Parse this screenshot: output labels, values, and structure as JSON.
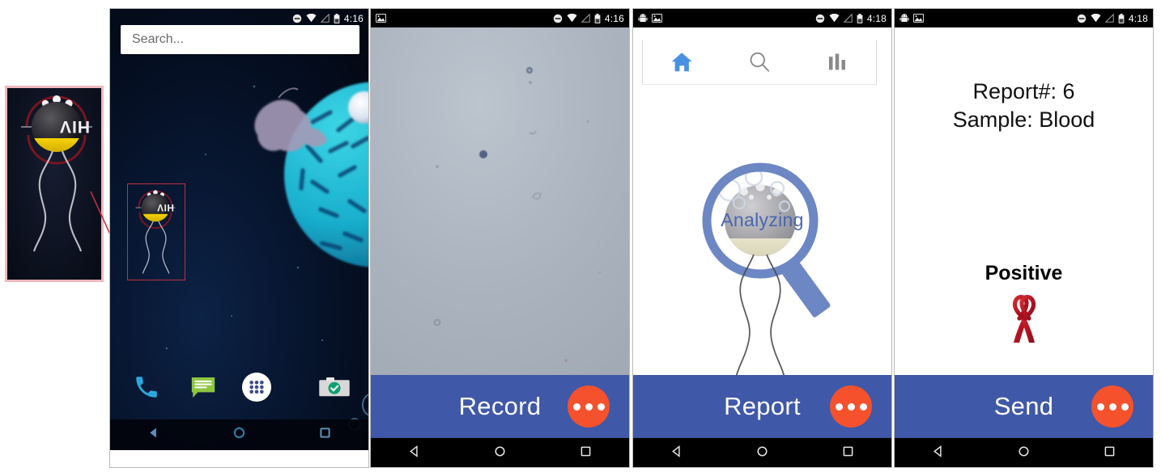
{
  "figure": {
    "panels": [
      {
        "id": "zoom-callout",
        "name": "HIV app icon magnified callout",
        "label": "HIV"
      },
      {
        "id": "home",
        "name": "Android home screen"
      },
      {
        "id": "record",
        "name": "Microscope capture screen"
      },
      {
        "id": "report",
        "name": "Analyzing report screen"
      },
      {
        "id": "send",
        "name": "Result send screen"
      }
    ]
  },
  "icon_callout": {
    "app_label": "HIV",
    "border_color": "#efb9bf",
    "background": "#0d1322",
    "connector_color": "#c03040"
  },
  "home": {
    "statusbar": {
      "time": "4:16",
      "icons": [
        "do-not-disturb-icon",
        "wifi-icon",
        "cell-signal-icon",
        "battery-icon"
      ]
    },
    "search": {
      "placeholder": "Search...",
      "value": ""
    },
    "app_icon": {
      "label": "HIV",
      "selected": true,
      "selection_color": "#c03040"
    },
    "dock": [
      {
        "name": "phone-icon",
        "label": "Phone",
        "color": "#29a8e0"
      },
      {
        "name": "messages-icon",
        "label": "Messages",
        "color": "#8dc63f"
      },
      {
        "name": "app-drawer-icon",
        "label": "Apps",
        "color": "#ffffff"
      },
      {
        "name": "camera-icon",
        "label": "Camera",
        "color": "#cfcfcf"
      }
    ],
    "navbar": [
      "back-icon",
      "home-icon",
      "recents-icon"
    ]
  },
  "record": {
    "statusbar": {
      "time": "4:16",
      "icons": [
        "image-icon",
        "do-not-disturb-icon",
        "wifi-icon",
        "cell-signal-icon",
        "battery-icon"
      ]
    },
    "viewfinder": {
      "description": "microscope field of view",
      "background": "#aab2bd"
    },
    "actionbar": {
      "label": "Record",
      "bar_color": "#4058a8",
      "fab_color": "#f4512c",
      "fab_icon": "overflow-dots-icon"
    },
    "navbar": [
      "back-icon",
      "home-icon",
      "recents-icon"
    ]
  },
  "report": {
    "statusbar": {
      "time": "4:18",
      "icons": [
        "android-icon",
        "image-icon",
        "do-not-disturb-icon",
        "wifi-icon",
        "cell-signal-icon",
        "battery-icon"
      ]
    },
    "tabs": [
      {
        "name": "tab-home",
        "icon": "home-icon",
        "active": true,
        "color": "#4a90e2"
      },
      {
        "name": "tab-search",
        "icon": "search-icon",
        "active": false,
        "color": "#8a8a8a"
      },
      {
        "name": "tab-stats",
        "icon": "bar-chart-icon",
        "active": false,
        "color": "#8a8a8a"
      }
    ],
    "status_text": "Analyzing",
    "status_color": "#4a66b0",
    "actionbar": {
      "label": "Report",
      "bar_color": "#4058a8",
      "fab_color": "#f4512c",
      "fab_icon": "overflow-dots-icon"
    },
    "navbar": [
      "back-icon",
      "home-icon",
      "recents-icon"
    ]
  },
  "send": {
    "statusbar": {
      "time": "4:18",
      "icons": [
        "android-icon",
        "image-icon",
        "do-not-disturb-icon",
        "wifi-icon",
        "cell-signal-icon",
        "battery-icon"
      ]
    },
    "report_number_line": "Report#: 6",
    "sample_line": "Sample: Blood",
    "result": "Positive",
    "result_icon": "awareness-ribbon-icon",
    "result_icon_color": "#c0172a",
    "actionbar": {
      "label": "Send",
      "bar_color": "#4058a8",
      "fab_color": "#f4512c",
      "fab_icon": "overflow-dots-icon"
    },
    "navbar": [
      "back-icon",
      "home-icon",
      "recents-icon"
    ]
  }
}
